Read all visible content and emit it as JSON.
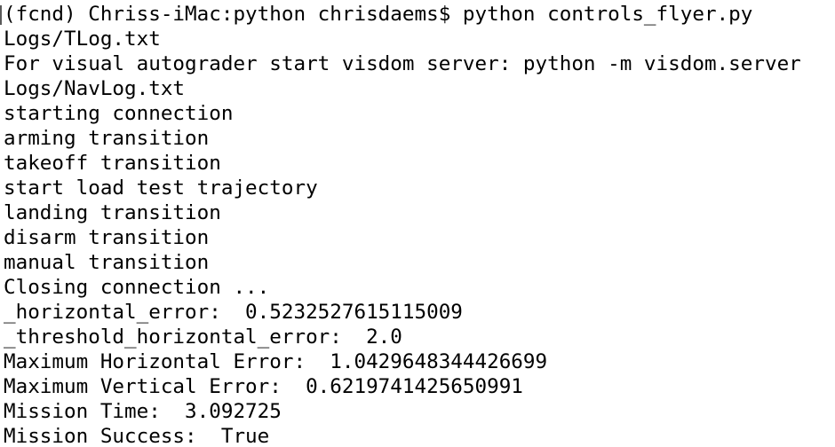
{
  "terminal": {
    "lines": [
      "(fcnd) Chriss-iMac:python chrisdaems$ python controls_flyer.py",
      "Logs/TLog.txt",
      "For visual autograder start visdom server: python -m visdom.server",
      "Logs/NavLog.txt",
      "starting connection",
      "arming transition",
      "takeoff transition",
      "start load test trajectory",
      "landing transition",
      "disarm transition",
      "manual transition",
      "Closing connection ...",
      "_horizontal_error:  0.5232527615115009",
      "_threshold_horizontal_error:  2.0",
      "Maximum Horizontal Error:  1.0429648344426699",
      "Maximum Vertical Error:  0.6219741425650991",
      "Mission Time:  3.092725",
      "Mission Success:  True"
    ]
  }
}
